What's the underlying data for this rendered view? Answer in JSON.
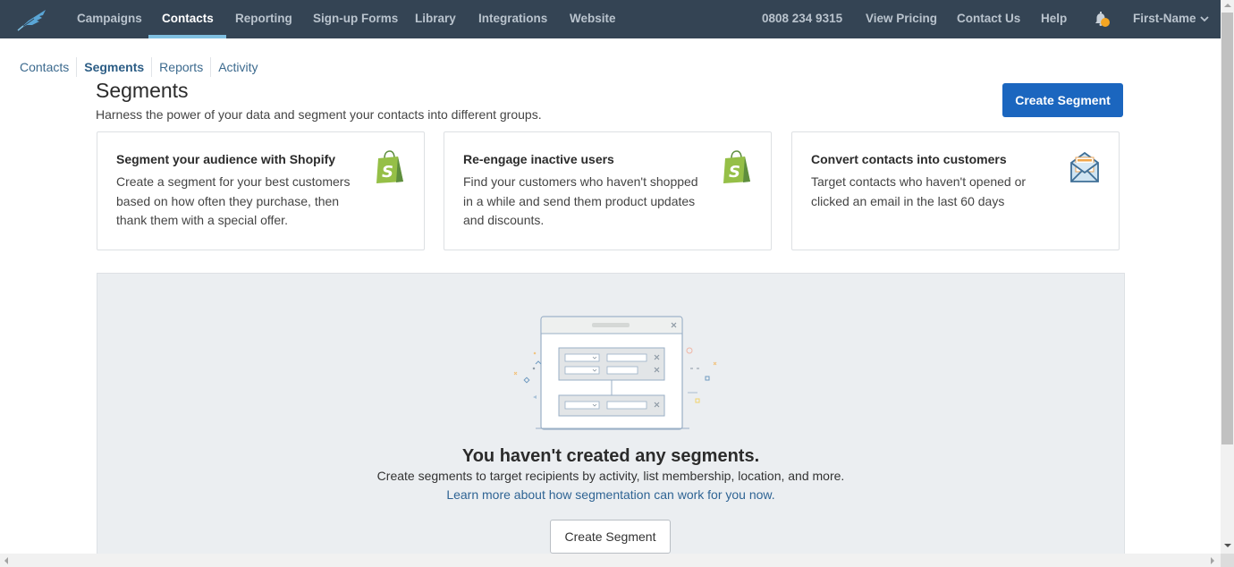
{
  "topnav": {
    "logo": "feather-logo-icon",
    "items": [
      {
        "label": "Campaigns",
        "active": false
      },
      {
        "label": "Contacts",
        "active": true
      },
      {
        "label": "Reporting",
        "active": false
      },
      {
        "label": "Sign-up Forms",
        "active": false
      },
      {
        "label": "Library",
        "active": false
      },
      {
        "label": "Integrations",
        "active": false
      },
      {
        "label": "Website",
        "active": false
      }
    ],
    "phone": "0808 234 9315",
    "view_pricing": "View Pricing",
    "contact_us": "Contact Us",
    "help": "Help",
    "notifications_icon": "bell-icon",
    "user_name": "First-Name"
  },
  "subnav": {
    "items": [
      {
        "label": "Contacts",
        "current": false
      },
      {
        "label": "Segments",
        "current": true
      },
      {
        "label": "Reports",
        "current": false
      },
      {
        "label": "Activity",
        "current": false
      }
    ]
  },
  "header": {
    "title": "Segments",
    "subtitle": "Harness the power of your data and segment your contacts into different groups.",
    "create_button": "Create Segment"
  },
  "cards": [
    {
      "title": "Segment your audience with Shopify",
      "body": "Create a segment for your best customers based on how often they purchase, then thank them with a special offer.",
      "icon": "shopify-bag-icon"
    },
    {
      "title": "Re-engage inactive users",
      "body": "Find your customers who haven't shopped in a while and send them product updates and discounts.",
      "icon": "shopify-bag-icon"
    },
    {
      "title": "Convert contacts into customers",
      "body": "Target contacts who haven't opened or clicked an email in the last 60 days",
      "icon": "open-envelope-icon"
    }
  ],
  "empty_state": {
    "title": "You haven't created any segments.",
    "subtitle": "Create segments to target recipients by activity, list membership, location, and more.",
    "link": "Learn more about how segmentation can work for you now.",
    "button": "Create Segment"
  },
  "colors": {
    "nav_bg": "#344454",
    "nav_active_underline": "#7fbfe0",
    "primary_button": "#1b66bf",
    "link": "#2f6494",
    "shopify_green": "#7ab648",
    "notification_dot": "#f5a623",
    "empty_panel_bg": "#ebeef1"
  }
}
